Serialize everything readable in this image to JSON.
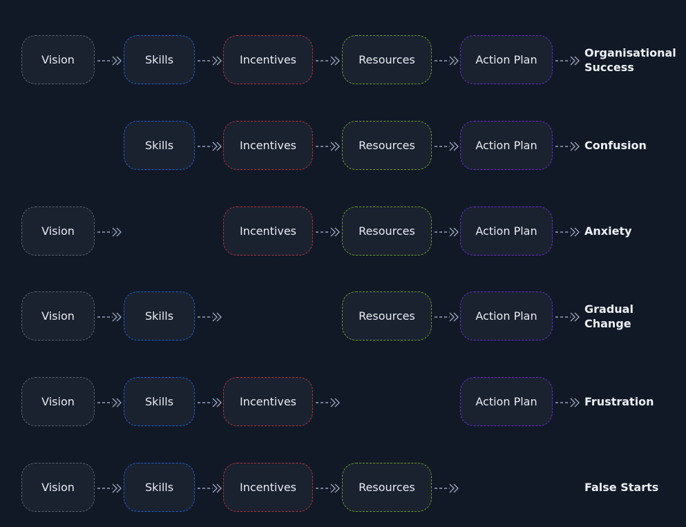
{
  "colors": {
    "background": "#111927",
    "node_fill": "#1a2230",
    "arrow": "#9ba6b8",
    "vision": "#5a6370",
    "skills": "#1f5fd1",
    "incentives": "#b83038",
    "resources": "#6aa21e",
    "action_plan": "#6b2ad1"
  },
  "rows": [
    {
      "steps": {
        "vision": "Vision",
        "skills": "Skills",
        "incentives": "Incentives",
        "resources": "Resources",
        "action_plan": "Action Plan"
      },
      "outcome": "Organisational Success"
    },
    {
      "steps": {
        "skills": "Skills",
        "incentives": "Incentives",
        "resources": "Resources",
        "action_plan": "Action Plan"
      },
      "outcome": "Confusion"
    },
    {
      "steps": {
        "vision": "Vision",
        "incentives": "Incentives",
        "resources": "Resources",
        "action_plan": "Action Plan"
      },
      "outcome": "Anxiety"
    },
    {
      "steps": {
        "vision": "Vision",
        "skills": "Skills",
        "resources": "Resources",
        "action_plan": "Action Plan"
      },
      "outcome": "Gradual Change"
    },
    {
      "steps": {
        "vision": "Vision",
        "skills": "Skills",
        "incentives": "Incentives",
        "action_plan": "Action Plan"
      },
      "outcome": "Frustration"
    },
    {
      "steps": {
        "vision": "Vision",
        "skills": "Skills",
        "incentives": "Incentives",
        "resources": "Resources"
      },
      "outcome": "False Starts"
    }
  ]
}
